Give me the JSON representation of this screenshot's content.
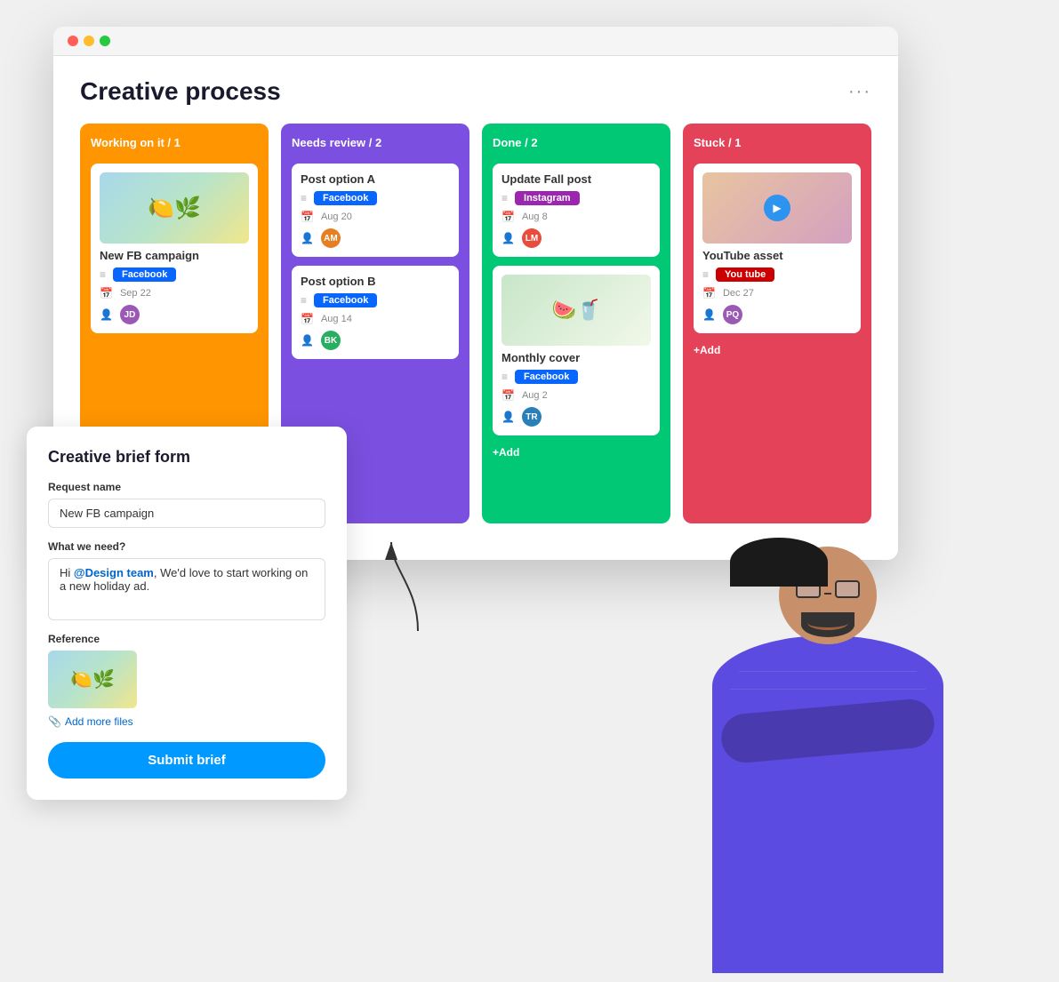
{
  "page": {
    "title": "Creative process",
    "more_icon": "···"
  },
  "browser": {
    "traffic_lights": [
      "red",
      "yellow",
      "green"
    ]
  },
  "columns": [
    {
      "id": "working",
      "header": "Working on it / 1",
      "color": "#FF9500",
      "cards": [
        {
          "id": "card-1",
          "has_image": true,
          "image_type": "limes",
          "title": "New FB campaign",
          "tag": "Facebook",
          "tag_color": "facebook",
          "date": "Sep 22",
          "avatar_label": "JD"
        }
      ]
    },
    {
      "id": "review",
      "header": "Needs review / 2",
      "color": "#7B4FE0",
      "cards": [
        {
          "id": "card-2",
          "title": "Post option A",
          "tag": "Facebook",
          "tag_color": "facebook",
          "date": "Aug 20",
          "avatar_label": "AM"
        },
        {
          "id": "card-3",
          "title": "Post option B",
          "tag": "Facebook",
          "tag_color": "facebook",
          "date": "Aug 14",
          "avatar_label": "BK"
        }
      ]
    },
    {
      "id": "done",
      "header": "Done / 2",
      "color": "#00C875",
      "cards": [
        {
          "id": "card-4",
          "title": "Update Fall post",
          "tag": "Instagram",
          "tag_color": "instagram",
          "date": "Aug 8",
          "avatar_label": "LM"
        },
        {
          "id": "card-5",
          "has_image": true,
          "image_type": "watermelon",
          "title": "Monthly cover",
          "tag": "Facebook",
          "tag_color": "facebook",
          "date": "Aug 2",
          "avatar_label": "TR"
        }
      ],
      "add_label": "+Add"
    },
    {
      "id": "stuck",
      "header": "Stuck / 1",
      "color": "#E44258",
      "cards": [
        {
          "id": "card-6",
          "has_image": true,
          "image_type": "youtube",
          "title": "YouTube asset",
          "tag": "You tube",
          "tag_color": "youtube",
          "date": "Dec 27",
          "avatar_label": "PQ"
        }
      ],
      "add_label": "+Add"
    }
  ],
  "form": {
    "title": "Creative brief form",
    "request_name_label": "Request name",
    "request_name_value": "New FB campaign",
    "what_we_need_label": "What we need?",
    "what_we_need_value": "Hi @Design team, We'd love to start working on a new holiday ad.",
    "mention_text": "@Design team",
    "reference_label": "Reference",
    "add_files_label": "Add more files",
    "submit_label": "Submit brief"
  }
}
